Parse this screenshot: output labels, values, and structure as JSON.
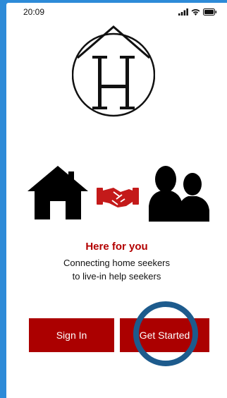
{
  "status": {
    "time": "20:09"
  },
  "hero": {
    "headline": "Here for you",
    "subtitle_line1": "Connecting home seekers",
    "subtitle_line2": "to live-in help seekers"
  },
  "actions": {
    "sign_in_label": "Sign In",
    "get_started_label": "Get Started"
  },
  "colors": {
    "accent": "#ab0000",
    "headline": "#b30000",
    "highlight_ring": "#1d5b8d",
    "background": "#2d8bd8"
  },
  "icons": [
    "signal-icon",
    "wifi-icon",
    "battery-icon",
    "house-logo-icon",
    "house-icon",
    "handshake-icon",
    "people-icon"
  ]
}
